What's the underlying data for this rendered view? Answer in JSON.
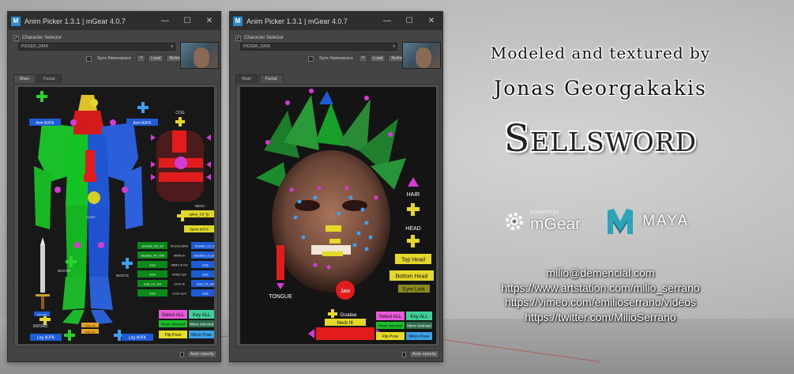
{
  "windows": [
    {
      "title": "Anim Picker 1.3.1 | mGear 4.0.7",
      "logo": "M",
      "minimize": "—",
      "maximize": "☐",
      "close": "✕",
      "character_selector": "Character Selector",
      "dropdown_value": "PICKER_DATA",
      "sync_namespace": "Sync Namespace",
      "question_btn": "?",
      "load_btn": "Load",
      "refresh_btn": "Refresh",
      "tabs": [
        {
          "label": "Main",
          "active": true
        },
        {
          "label": "Facial",
          "active": false
        }
      ],
      "auto_opacity": "Auto opacity"
    },
    {
      "title": "Anim Picker 1.3.1 | mGear 4.0.7",
      "logo": "M",
      "minimize": "—",
      "maximize": "☐",
      "close": "✕",
      "character_selector": "Character Selector",
      "dropdown_value": "PICKER_DATA",
      "sync_namespace": "Sync Namespace",
      "question_btn": "?",
      "load_btn": "Load",
      "refresh_btn": "Refresh",
      "tabs": [
        {
          "label": "Main",
          "active": false
        },
        {
          "label": "Facial",
          "active": true
        }
      ],
      "auto_opacity": "Auto opacity"
    }
  ],
  "main_picker": {
    "arm_ikfk_left": "Arm IK/FK",
    "arm_ikfk_right": "Arm IK/FK",
    "cog": "COG",
    "neck": "NECK",
    "spine_co_fp": "spine_C0_fp",
    "spine_ikfk": "Spine IK/FK",
    "shirt": "SHIRT",
    "boots_left": "BOOTS",
    "boots_right": "BOOTS",
    "sword": "SWORD",
    "leg_ikfk_left": "Leg IK/FK",
    "leg_ikfk_right": "Leg IK/FK",
    "table_left": [
      "shoulder_R0_ctrl",
      "shoulder_R0_orbit",
      "Auto",
      "Auto",
      "local_C0_root",
      "Auto"
    ],
    "table_mid": [
      "SHOULDERS",
      "ARMS IK",
      "ARMS IK Rot",
      "ARMS UpV",
      "LEGS IK",
      "LEGS UpV"
    ],
    "table_right": [
      "shoulder_L0_ctrl",
      "shoulder_L0_orbit",
      "Auto",
      "Auto",
      "local_C0_root",
      "Auto"
    ],
    "select_all": "Select ALL",
    "key_all": "Key ALL",
    "reset_selected": "Reset Selected",
    "mirror_selected": "Mirror Selected",
    "flip_pose": "Flip Pose",
    "mirror_pose": "Mirror Pose",
    "small_hand": "hand_R0",
    "small_root": "world_ctrl",
    "small_body": "body_C0"
  },
  "facial_picker": {
    "hair": "HAIR",
    "head": "HEAD",
    "top_head": "Top Head",
    "bottom_head": "Bottom Head",
    "eyes_look": "Eyes Look",
    "tongue": "TONGUE",
    "jaw": "Jaw",
    "goatee": "Goatee",
    "neck_ik": "Neck IK",
    "select_all": "Select ALL",
    "key_all": "Key ALL",
    "reset_selected": "Reset Selected",
    "mirror_selected": "Mirror Selected",
    "flip_pose": "Flip Pose",
    "mirror_pose": "Mirror Pose"
  },
  "credits": {
    "modeled_line": "Modeled and textured by",
    "author": "Jonas Georgakakis",
    "project": "Sellsword",
    "powered_by": "powered by",
    "mgear": "mGear",
    "maya": "MAYA",
    "links": [
      "milio@demencial.com",
      "https://www.artstation.com/milio_serrano",
      "https://vimeo.com/emilioserrano/videos",
      "https://twitter.com/MilioSerrano"
    ]
  },
  "colors": {
    "green": "#19c219",
    "blue": "#1e5bd6",
    "red": "#e01f1f",
    "yellow": "#e8e12b",
    "magenta": "#d43ad4",
    "window": "#444444",
    "stage": "#181818"
  }
}
